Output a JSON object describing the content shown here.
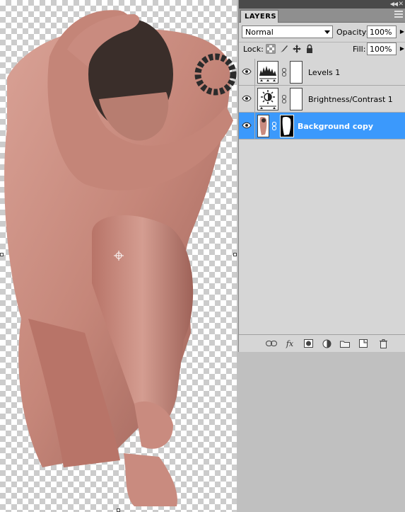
{
  "panel": {
    "title_tab": "LAYERS",
    "collapse_icon": "double-chevron-left-icon",
    "close_icon": "close-x-icon",
    "menu_icon": "panel-menu-icon"
  },
  "blend": {
    "mode": "Normal",
    "opacity_label": "Opacity:",
    "opacity_value": "100%",
    "fill_label": "Fill:",
    "fill_value": "100%",
    "lock_label": "Lock:"
  },
  "layers": [
    {
      "name": "Levels 1",
      "visible": true,
      "selected": false,
      "type": "levels-adjustment"
    },
    {
      "name": "Brightness/Contrast 1",
      "visible": true,
      "selected": false,
      "type": "brightness-contrast-adjustment"
    },
    {
      "name": "Background copy",
      "visible": true,
      "selected": true,
      "type": "pixel-with-mask"
    }
  ],
  "colors": {
    "selection": "#3b99fc",
    "panel_bg": "#d6d6d6",
    "workspace_bg": "#c0c0c0",
    "skin": "#c98b7f"
  }
}
